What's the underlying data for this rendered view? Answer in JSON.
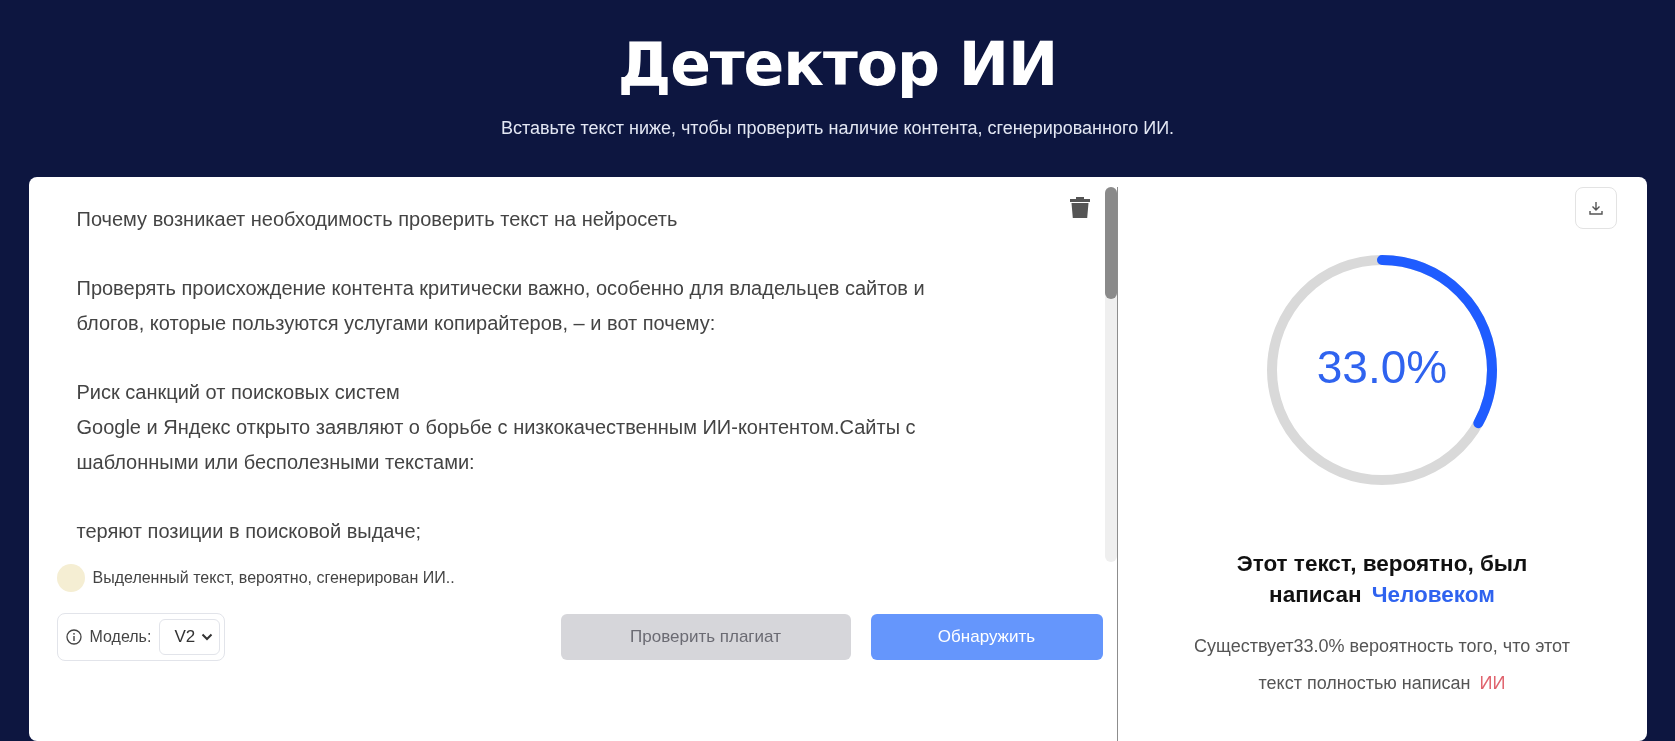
{
  "header": {
    "title": "Детектор ИИ",
    "subtitle": "Вставьте текст ниже, чтобы проверить наличие контента, сгенерированного ИИ."
  },
  "editor": {
    "blocks": [
      {
        "lines": [
          "Почему возникает необходимость проверить текст на нейросеть"
        ]
      },
      {
        "lines": [
          "Проверять происхождение контента критически важно, особенно для владельцев сайтов и",
          "блогов, которые пользуются услугами копирайтеров, – и вот почему:"
        ]
      },
      {
        "lines": [
          "Риск санкций от поисковых систем",
          "Google и Яндекс открыто заявляют о борьбе с низкокачественным ИИ-контентом.Сайты с",
          "шаблонными или бесполезными текстами:"
        ]
      },
      {
        "lines": [
          "теряют позиции в поисковой выдаче;"
        ]
      }
    ],
    "legend": "Выделенный текст, вероятно, сгенерирован ИИ.."
  },
  "controls": {
    "model_label": "Модель:",
    "model_value": "V2",
    "plagiarism_button": "Проверить плагиат",
    "detect_button": "Обнаружить"
  },
  "result": {
    "level": 0.33,
    "percent": "33.0%",
    "heading": {
      "text": "Этот текст, вероятно, был написан",
      "highlight": "Человеком"
    },
    "description": {
      "text": "Существует33.0% вероятность того, что этот текст полностью написан",
      "highlight": "ИИ"
    }
  }
}
